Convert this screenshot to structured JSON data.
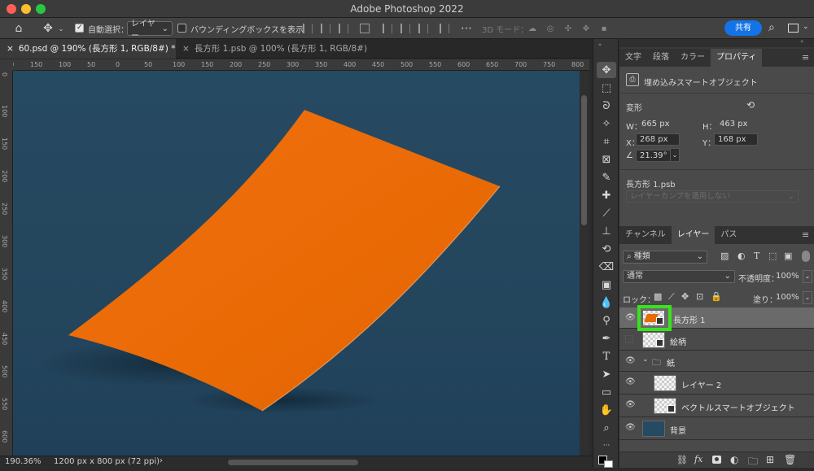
{
  "app_title": "Adobe Photoshop 2022",
  "options_bar": {
    "auto_select_label": "自動選択：",
    "auto_select_target": "レイヤー",
    "bounding_box_label": "バウンディングボックスを表示",
    "three_d_mode_label": "3D モード：",
    "share_label": "共有"
  },
  "doc_tabs": [
    {
      "label": "60.psd @ 190% (長方形 1, RGB/8#) *",
      "active": true
    },
    {
      "label": "長方形 1.psb @ 100% (長方形 1, RGB/8#)",
      "active": false
    }
  ],
  "ruler": {
    "top": [
      "200",
      "150",
      "100",
      "50",
      "0",
      "50",
      "100",
      "150",
      "200",
      "250",
      "300",
      "350",
      "400",
      "450",
      "500",
      "550",
      "600",
      "650",
      "700",
      "750",
      "800"
    ],
    "left": [
      "0",
      "100",
      "150",
      "200",
      "250",
      "300",
      "350",
      "400",
      "450",
      "500",
      "550",
      "600"
    ]
  },
  "status": {
    "zoom": "190.36%",
    "doc_size": "1200 px x 800 px (72 ppi)"
  },
  "properties_panel": {
    "tabs": [
      "文字",
      "段落",
      "カラー",
      "プロパティ"
    ],
    "object_type": "埋め込みスマートオブジェクト",
    "transform_label": "変形",
    "w_label": "W：",
    "w_value": "665 px",
    "h_label": "H：",
    "h_value": "463 px",
    "x_label": "X：",
    "x_value": "268 px",
    "y_label": "Y：",
    "y_value": "168 px",
    "angle_value": "21.39°",
    "linked_file": "長方形 1.psb",
    "layer_comp_placeholder": "レイヤーカンプを適用しない"
  },
  "layers_panel": {
    "tabs": [
      "チャンネル",
      "レイヤー",
      "パス"
    ],
    "filter_kind": "種類",
    "blend_mode": "通常",
    "opacity_label": "不透明度：",
    "opacity_value": "100%",
    "lock_label": "ロック：",
    "fill_label": "塗り：",
    "fill_value": "100%",
    "layers": [
      {
        "name": "長方形 1",
        "visible": true,
        "selected": true,
        "type": "smart-object"
      },
      {
        "name": "絵柄",
        "visible": false,
        "selected": false,
        "type": "smart-object"
      },
      {
        "name": "紙",
        "visible": true,
        "selected": false,
        "type": "group"
      },
      {
        "name": "レイヤー 2",
        "visible": true,
        "selected": false,
        "type": "pixel"
      },
      {
        "name": "ベクトルスマートオブジェクト",
        "visible": true,
        "selected": false,
        "type": "smart-object"
      },
      {
        "name": "背景",
        "visible": true,
        "selected": false,
        "type": "background"
      }
    ],
    "footer_icons": [
      "link-icon",
      "fx-icon",
      "mask-icon",
      "adjustment-icon",
      "folder-icon",
      "new-layer-icon",
      "trash-icon"
    ]
  },
  "colors": {
    "accent": "#1473e6",
    "highlight": "#39e21f",
    "paper_orange": "#ea6a06",
    "canvas_bg": "#264a62"
  }
}
